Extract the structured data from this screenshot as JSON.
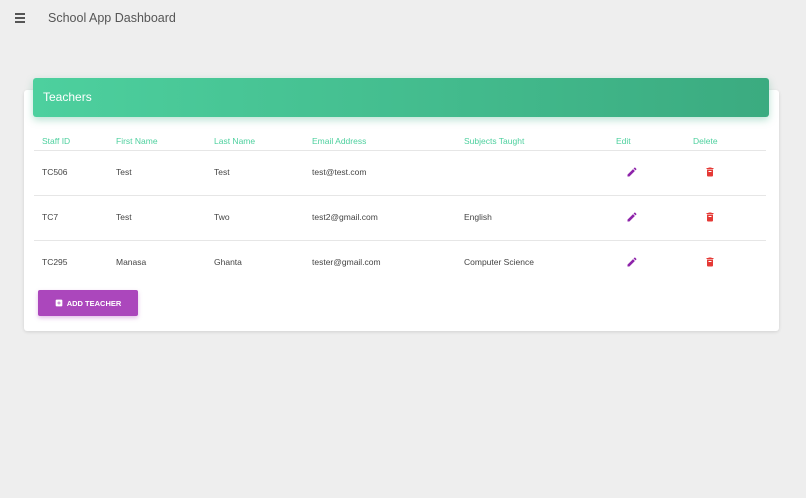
{
  "app": {
    "title": "School App Dashboard"
  },
  "teachers": {
    "title": "Teachers",
    "columns": [
      "Staff ID",
      "First Name",
      "Last Name",
      "Email Address",
      "Subjects Taught",
      "Edit",
      "Delete"
    ],
    "rows": [
      {
        "staff_id": "TC506",
        "first_name": "Test",
        "last_name": "Test",
        "email": "test@test.com",
        "subjects": ""
      },
      {
        "staff_id": "TC7",
        "first_name": "Test",
        "last_name": "Two",
        "email": "test2@gmail.com",
        "subjects": "English"
      },
      {
        "staff_id": "TC295",
        "first_name": "Manasa",
        "last_name": "Ghanta",
        "email": "tester@gmail.com",
        "subjects": "Computer Science"
      }
    ],
    "add_button_label": "ADD TEACHER"
  },
  "colors": {
    "header_start": "#4dd09e",
    "header_end": "#3bab80",
    "edit_icon": "#8e24aa",
    "delete_icon": "#e53935",
    "add_button": "#ab47bc"
  },
  "icons": {
    "menu": "hamburger-menu-icon",
    "edit": "pencil-icon",
    "delete": "trash-icon",
    "add": "plus-box-icon"
  }
}
